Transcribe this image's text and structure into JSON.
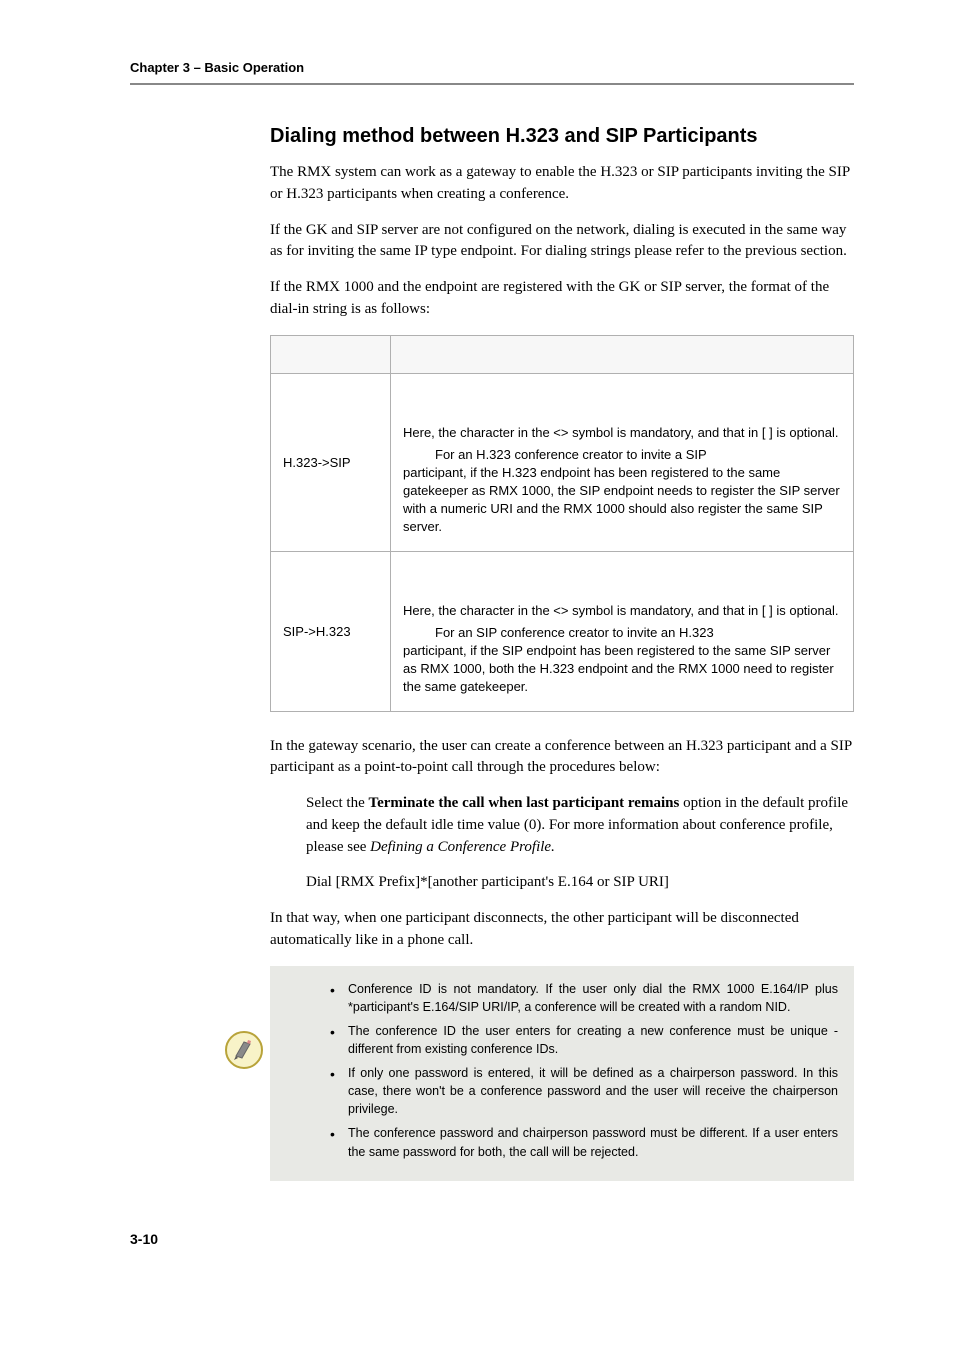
{
  "chapter": "Chapter 3 – Basic Operation",
  "section_title": "Dialing method between H.323 and SIP Participants",
  "intro_paras": [
    "The RMX system can work as a gateway to enable the H.323 or SIP participants inviting the SIP or H.323 participants when creating a conference.",
    "If the GK and SIP server are not configured on the network, dialing is executed in the same way as for inviting the same IP type endpoint. For dialing strings please refer to the previous section.",
    "If the RMX 1000 and the endpoint are registered with the GK or SIP server, the format of the dial-in string is as follows:"
  ],
  "table": {
    "rows": [
      {
        "left": "H.323->SIP",
        "lead": "Here, the character in the <> symbol is mandatory, and that in [ ] is optional.",
        "indent": "For an H.323 conference creator to invite a SIP",
        "rest": "participant, if the H.323 endpoint has been registered to the same gatekeeper as RMX 1000, the SIP endpoint needs to register the SIP server with a numeric URI and the RMX 1000 should also register the same SIP server."
      },
      {
        "left": "SIP->H.323",
        "lead": "Here, the character in the <> symbol is mandatory, and that in [ ] is optional.",
        "indent": "For an SIP conference creator to invite an H.323",
        "rest": "participant, if the SIP endpoint has been registered to the same SIP server as RMX 1000, both the H.323 endpoint and the RMX 1000 need to register the same gatekeeper."
      }
    ]
  },
  "gateway_para": "In the gateway scenario, the user can create a conference between an H.323 participant and a SIP participant as a point-to-point call through the procedures below:",
  "step1_prefix": "Select the ",
  "step1_bold": "Terminate the call when last participant remains",
  "step1_mid": " option in the default profile and keep the default idle time value (0). For more information about conference profile, please see ",
  "step1_italic": "Defining a Conference Profile.",
  "step2": "Dial [RMX Prefix]*[another participant's E.164 or SIP URI]",
  "closing_para": "In that way, when one participant disconnects, the other participant will be disconnected automatically like in a phone call.",
  "notes": [
    "Conference ID is not mandatory. If the user only dial the RMX 1000 E.164/IP plus *participant's E.164/SIP URI/IP, a conference will be created with a random NID.",
    "The conference ID the user enters for creating a new conference must be unique - different from existing conference IDs.",
    "If only one password is entered, it will be defined as a chairperson password. In this case, there won't be a conference password and the user will receive the chairperson privilege.",
    "The conference password and chairperson password must be different. If a user enters the same password for both, the call will be rejected."
  ],
  "page_num": "3-10"
}
